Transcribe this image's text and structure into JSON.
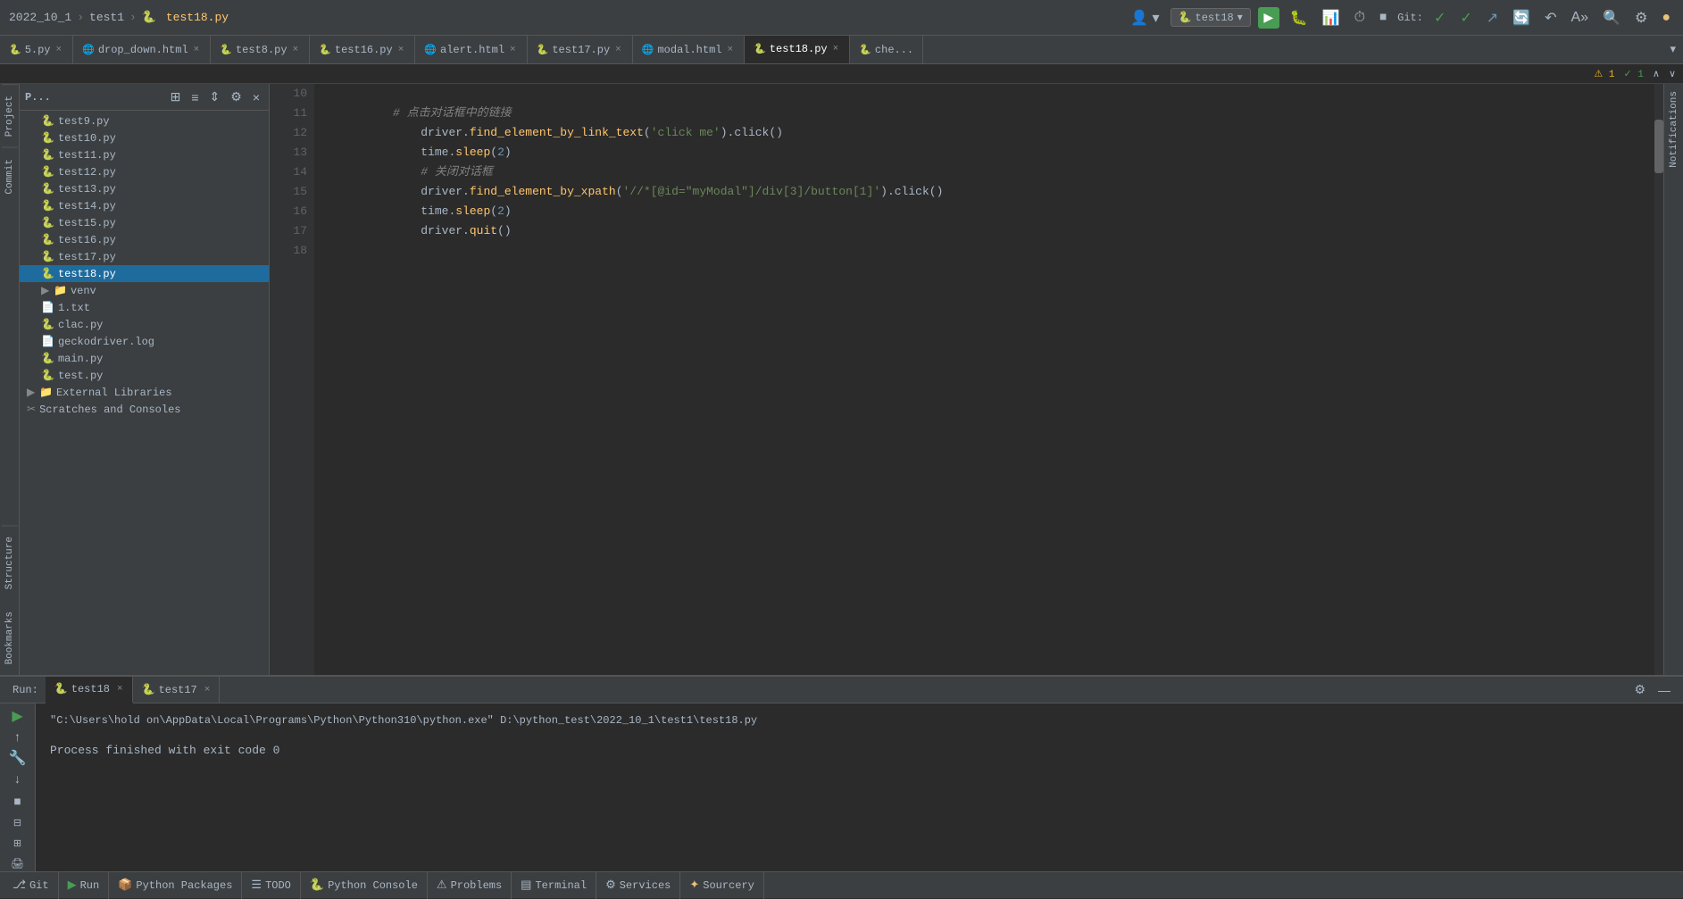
{
  "titlebar": {
    "breadcrumb": [
      "2022_10_1",
      "test1",
      "test18.py"
    ],
    "branch": "test18",
    "run_label": "Run",
    "git_label": "Git:"
  },
  "tabs": [
    {
      "label": "5.py",
      "active": false,
      "closable": true
    },
    {
      "label": "drop_down.html",
      "active": false,
      "closable": true
    },
    {
      "label": "test8.py",
      "active": false,
      "closable": true
    },
    {
      "label": "test16.py",
      "active": false,
      "closable": true
    },
    {
      "label": "alert.html",
      "active": false,
      "closable": true
    },
    {
      "label": "test17.py",
      "active": false,
      "closable": true
    },
    {
      "label": "modal.html",
      "active": false,
      "closable": true
    },
    {
      "label": "test18.py",
      "active": true,
      "closable": true
    },
    {
      "label": "che...",
      "active": false,
      "closable": false
    }
  ],
  "editor": {
    "lines": [
      {
        "num": 10,
        "tokens": [
          {
            "t": "cm",
            "v": "# 点击对话框中的链接"
          }
        ]
      },
      {
        "num": 11,
        "tokens": [
          {
            "t": "id",
            "v": "driver"
          },
          {
            "t": "p",
            "v": "."
          },
          {
            "t": "fn",
            "v": "find_element_by_link_text"
          },
          {
            "t": "p",
            "v": "("
          },
          {
            "t": "str",
            "v": "'click me'"
          },
          {
            "t": "p",
            "v": ").click()"
          }
        ]
      },
      {
        "num": 12,
        "tokens": [
          {
            "t": "id",
            "v": "time"
          },
          {
            "t": "p",
            "v": "."
          },
          {
            "t": "fn",
            "v": "sleep"
          },
          {
            "t": "p",
            "v": "("
          },
          {
            "t": "num",
            "v": "2"
          },
          {
            "t": "p",
            "v": ")"
          }
        ]
      },
      {
        "num": 13,
        "tokens": [
          {
            "t": "cm",
            "v": "# 关闭对话框"
          }
        ]
      },
      {
        "num": 14,
        "tokens": [
          {
            "t": "id",
            "v": "driver"
          },
          {
            "t": "p",
            "v": "."
          },
          {
            "t": "fn",
            "v": "find_element_by_xpath"
          },
          {
            "t": "p",
            "v": "("
          },
          {
            "t": "str",
            "v": "'//*[@id=\"myModal\"]/div[3]/button[1]'"
          },
          {
            "t": "p",
            "v": ").click()"
          }
        ]
      },
      {
        "num": 15,
        "tokens": [
          {
            "t": "id",
            "v": "time"
          },
          {
            "t": "p",
            "v": "."
          },
          {
            "t": "fn",
            "v": "sleep"
          },
          {
            "t": "p",
            "v": "("
          },
          {
            "t": "num",
            "v": "2"
          },
          {
            "t": "p",
            "v": ")"
          }
        ]
      },
      {
        "num": 16,
        "tokens": [
          {
            "t": "id",
            "v": "driver"
          },
          {
            "t": "p",
            "v": "."
          },
          {
            "t": "fn",
            "v": "quit"
          },
          {
            "t": "p",
            "v": "()"
          }
        ]
      },
      {
        "num": 17,
        "tokens": []
      },
      {
        "num": 18,
        "tokens": []
      }
    ]
  },
  "project_tree": {
    "items": [
      {
        "label": "test9.py",
        "type": "py",
        "indent": 1,
        "selected": false
      },
      {
        "label": "test10.py",
        "type": "py",
        "indent": 1,
        "selected": false
      },
      {
        "label": "test11.py",
        "type": "py",
        "indent": 1,
        "selected": false
      },
      {
        "label": "test12.py",
        "type": "py",
        "indent": 1,
        "selected": false
      },
      {
        "label": "test13.py",
        "type": "py",
        "indent": 1,
        "selected": false
      },
      {
        "label": "test14.py",
        "type": "py",
        "indent": 1,
        "selected": false
      },
      {
        "label": "test15.py",
        "type": "py",
        "indent": 1,
        "selected": false
      },
      {
        "label": "test16.py",
        "type": "py",
        "indent": 1,
        "selected": false
      },
      {
        "label": "test17.py",
        "type": "py",
        "indent": 1,
        "selected": false
      },
      {
        "label": "test18.py",
        "type": "py",
        "indent": 1,
        "selected": true
      },
      {
        "label": "venv",
        "type": "folder",
        "indent": 1,
        "selected": false,
        "arrow": true
      },
      {
        "label": "1.txt",
        "type": "txt",
        "indent": 1,
        "selected": false
      },
      {
        "label": "clac.py",
        "type": "py",
        "indent": 1,
        "selected": false
      },
      {
        "label": "geckodriver.log",
        "type": "log",
        "indent": 1,
        "selected": false
      },
      {
        "label": "main.py",
        "type": "py",
        "indent": 1,
        "selected": false
      },
      {
        "label": "test.py",
        "type": "py",
        "indent": 1,
        "selected": false
      },
      {
        "label": "External Libraries",
        "type": "folder",
        "indent": 0,
        "selected": false,
        "arrow": true
      },
      {
        "label": "Scratches and Consoles",
        "type": "scratches",
        "indent": 0,
        "selected": false
      }
    ]
  },
  "run_panel": {
    "label": "Run:",
    "tabs": [
      {
        "label": "test18",
        "active": true,
        "closable": true
      },
      {
        "label": "test17",
        "active": false,
        "closable": true
      }
    ],
    "command": "\"C:\\Users\\hold on\\AppData\\Local\\Programs\\Python\\Python310\\python.exe\" D:\\python_test\\2022_10_1\\test1\\test18.py",
    "output": "Process finished with exit code 0"
  },
  "status_bar": {
    "items": [
      {
        "label": "Git",
        "icon": "⎇"
      },
      {
        "label": "Run",
        "icon": "▶"
      },
      {
        "label": "Python Packages",
        "icon": "📦"
      },
      {
        "label": "TODO",
        "icon": "☰"
      },
      {
        "label": "Python Console",
        "icon": "🐍"
      },
      {
        "label": "Problems",
        "icon": "⚠"
      },
      {
        "label": "Terminal",
        "icon": "▤"
      },
      {
        "label": "Services",
        "icon": "⚙"
      },
      {
        "label": "Sourcery",
        "icon": "✦"
      }
    ]
  },
  "notifications": {
    "warnings": "1",
    "checks": "1"
  },
  "sidebar_tabs": [
    "Project",
    "Commit",
    "Structure",
    "Bookmarks"
  ]
}
